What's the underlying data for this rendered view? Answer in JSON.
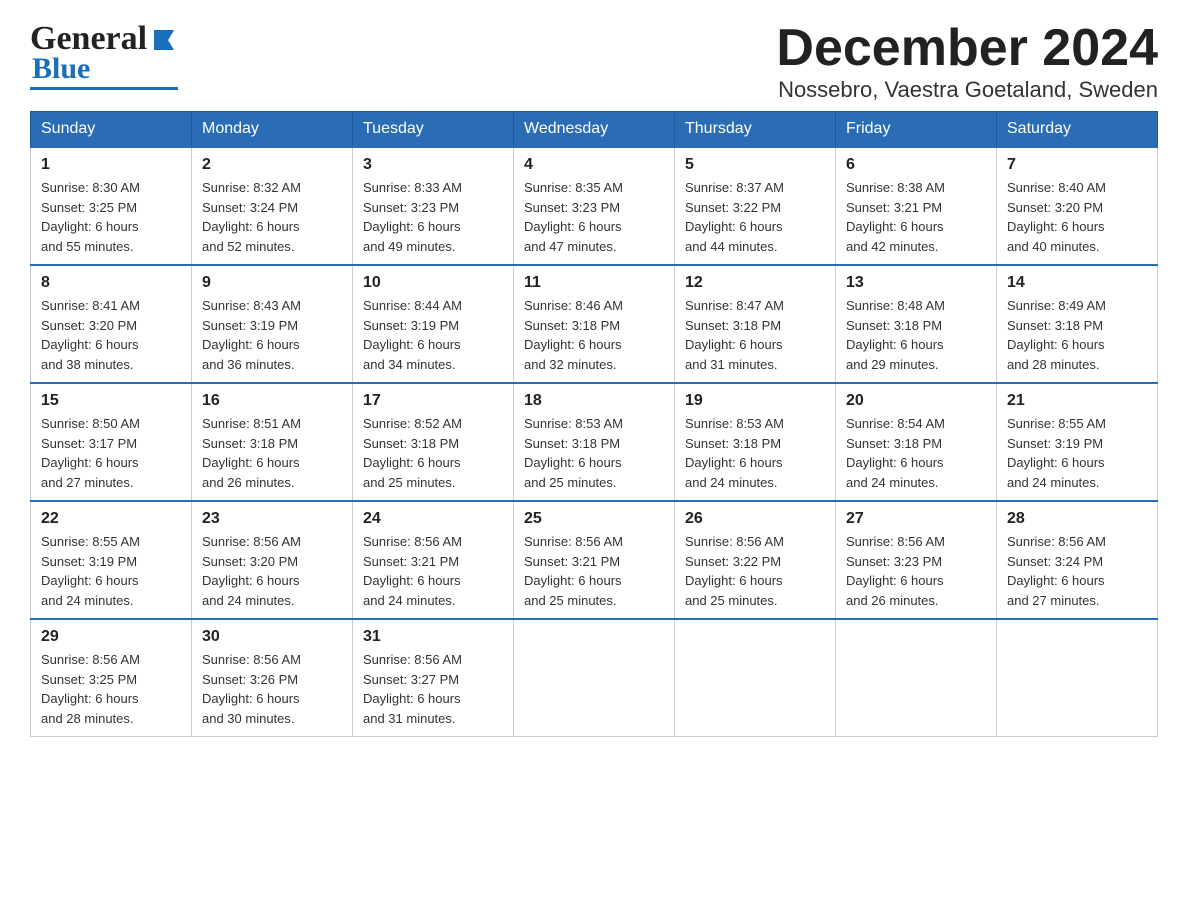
{
  "header": {
    "logo": {
      "general": "General",
      "blue": "Blue"
    },
    "title": "December 2024",
    "location": "Nossebro, Vaestra Goetaland, Sweden"
  },
  "weekdays": [
    "Sunday",
    "Monday",
    "Tuesday",
    "Wednesday",
    "Thursday",
    "Friday",
    "Saturday"
  ],
  "weeks": [
    [
      {
        "day": "1",
        "sunrise": "Sunrise: 8:30 AM",
        "sunset": "Sunset: 3:25 PM",
        "daylight": "Daylight: 6 hours",
        "minutes": "and 55 minutes."
      },
      {
        "day": "2",
        "sunrise": "Sunrise: 8:32 AM",
        "sunset": "Sunset: 3:24 PM",
        "daylight": "Daylight: 6 hours",
        "minutes": "and 52 minutes."
      },
      {
        "day": "3",
        "sunrise": "Sunrise: 8:33 AM",
        "sunset": "Sunset: 3:23 PM",
        "daylight": "Daylight: 6 hours",
        "minutes": "and 49 minutes."
      },
      {
        "day": "4",
        "sunrise": "Sunrise: 8:35 AM",
        "sunset": "Sunset: 3:23 PM",
        "daylight": "Daylight: 6 hours",
        "minutes": "and 47 minutes."
      },
      {
        "day": "5",
        "sunrise": "Sunrise: 8:37 AM",
        "sunset": "Sunset: 3:22 PM",
        "daylight": "Daylight: 6 hours",
        "minutes": "and 44 minutes."
      },
      {
        "day": "6",
        "sunrise": "Sunrise: 8:38 AM",
        "sunset": "Sunset: 3:21 PM",
        "daylight": "Daylight: 6 hours",
        "minutes": "and 42 minutes."
      },
      {
        "day": "7",
        "sunrise": "Sunrise: 8:40 AM",
        "sunset": "Sunset: 3:20 PM",
        "daylight": "Daylight: 6 hours",
        "minutes": "and 40 minutes."
      }
    ],
    [
      {
        "day": "8",
        "sunrise": "Sunrise: 8:41 AM",
        "sunset": "Sunset: 3:20 PM",
        "daylight": "Daylight: 6 hours",
        "minutes": "and 38 minutes."
      },
      {
        "day": "9",
        "sunrise": "Sunrise: 8:43 AM",
        "sunset": "Sunset: 3:19 PM",
        "daylight": "Daylight: 6 hours",
        "minutes": "and 36 minutes."
      },
      {
        "day": "10",
        "sunrise": "Sunrise: 8:44 AM",
        "sunset": "Sunset: 3:19 PM",
        "daylight": "Daylight: 6 hours",
        "minutes": "and 34 minutes."
      },
      {
        "day": "11",
        "sunrise": "Sunrise: 8:46 AM",
        "sunset": "Sunset: 3:18 PM",
        "daylight": "Daylight: 6 hours",
        "minutes": "and 32 minutes."
      },
      {
        "day": "12",
        "sunrise": "Sunrise: 8:47 AM",
        "sunset": "Sunset: 3:18 PM",
        "daylight": "Daylight: 6 hours",
        "minutes": "and 31 minutes."
      },
      {
        "day": "13",
        "sunrise": "Sunrise: 8:48 AM",
        "sunset": "Sunset: 3:18 PM",
        "daylight": "Daylight: 6 hours",
        "minutes": "and 29 minutes."
      },
      {
        "day": "14",
        "sunrise": "Sunrise: 8:49 AM",
        "sunset": "Sunset: 3:18 PM",
        "daylight": "Daylight: 6 hours",
        "minutes": "and 28 minutes."
      }
    ],
    [
      {
        "day": "15",
        "sunrise": "Sunrise: 8:50 AM",
        "sunset": "Sunset: 3:17 PM",
        "daylight": "Daylight: 6 hours",
        "minutes": "and 27 minutes."
      },
      {
        "day": "16",
        "sunrise": "Sunrise: 8:51 AM",
        "sunset": "Sunset: 3:18 PM",
        "daylight": "Daylight: 6 hours",
        "minutes": "and 26 minutes."
      },
      {
        "day": "17",
        "sunrise": "Sunrise: 8:52 AM",
        "sunset": "Sunset: 3:18 PM",
        "daylight": "Daylight: 6 hours",
        "minutes": "and 25 minutes."
      },
      {
        "day": "18",
        "sunrise": "Sunrise: 8:53 AM",
        "sunset": "Sunset: 3:18 PM",
        "daylight": "Daylight: 6 hours",
        "minutes": "and 25 minutes."
      },
      {
        "day": "19",
        "sunrise": "Sunrise: 8:53 AM",
        "sunset": "Sunset: 3:18 PM",
        "daylight": "Daylight: 6 hours",
        "minutes": "and 24 minutes."
      },
      {
        "day": "20",
        "sunrise": "Sunrise: 8:54 AM",
        "sunset": "Sunset: 3:18 PM",
        "daylight": "Daylight: 6 hours",
        "minutes": "and 24 minutes."
      },
      {
        "day": "21",
        "sunrise": "Sunrise: 8:55 AM",
        "sunset": "Sunset: 3:19 PM",
        "daylight": "Daylight: 6 hours",
        "minutes": "and 24 minutes."
      }
    ],
    [
      {
        "day": "22",
        "sunrise": "Sunrise: 8:55 AM",
        "sunset": "Sunset: 3:19 PM",
        "daylight": "Daylight: 6 hours",
        "minutes": "and 24 minutes."
      },
      {
        "day": "23",
        "sunrise": "Sunrise: 8:56 AM",
        "sunset": "Sunset: 3:20 PM",
        "daylight": "Daylight: 6 hours",
        "minutes": "and 24 minutes."
      },
      {
        "day": "24",
        "sunrise": "Sunrise: 8:56 AM",
        "sunset": "Sunset: 3:21 PM",
        "daylight": "Daylight: 6 hours",
        "minutes": "and 24 minutes."
      },
      {
        "day": "25",
        "sunrise": "Sunrise: 8:56 AM",
        "sunset": "Sunset: 3:21 PM",
        "daylight": "Daylight: 6 hours",
        "minutes": "and 25 minutes."
      },
      {
        "day": "26",
        "sunrise": "Sunrise: 8:56 AM",
        "sunset": "Sunset: 3:22 PM",
        "daylight": "Daylight: 6 hours",
        "minutes": "and 25 minutes."
      },
      {
        "day": "27",
        "sunrise": "Sunrise: 8:56 AM",
        "sunset": "Sunset: 3:23 PM",
        "daylight": "Daylight: 6 hours",
        "minutes": "and 26 minutes."
      },
      {
        "day": "28",
        "sunrise": "Sunrise: 8:56 AM",
        "sunset": "Sunset: 3:24 PM",
        "daylight": "Daylight: 6 hours",
        "minutes": "and 27 minutes."
      }
    ],
    [
      {
        "day": "29",
        "sunrise": "Sunrise: 8:56 AM",
        "sunset": "Sunset: 3:25 PM",
        "daylight": "Daylight: 6 hours",
        "minutes": "and 28 minutes."
      },
      {
        "day": "30",
        "sunrise": "Sunrise: 8:56 AM",
        "sunset": "Sunset: 3:26 PM",
        "daylight": "Daylight: 6 hours",
        "minutes": "and 30 minutes."
      },
      {
        "day": "31",
        "sunrise": "Sunrise: 8:56 AM",
        "sunset": "Sunset: 3:27 PM",
        "daylight": "Daylight: 6 hours",
        "minutes": "and 31 minutes."
      },
      null,
      null,
      null,
      null
    ]
  ]
}
